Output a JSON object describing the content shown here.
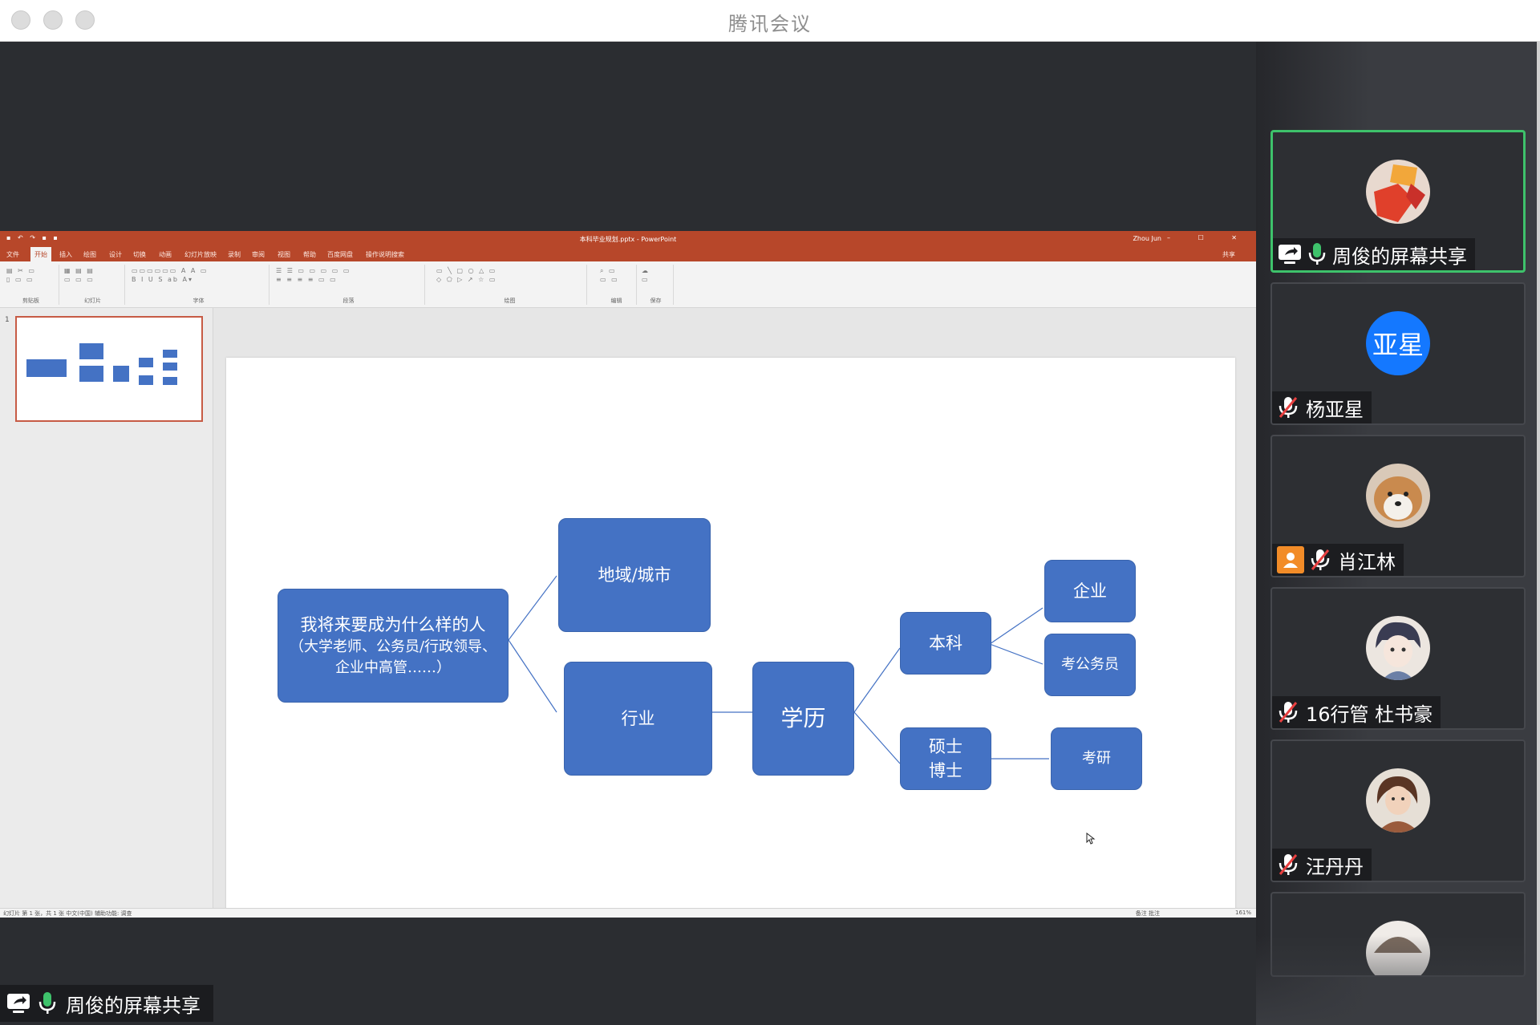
{
  "window": {
    "title": "腾讯会议"
  },
  "ppt": {
    "doc_title": "本科毕业规划.pptx  -  PowerPoint",
    "user": "Zhou Jun",
    "quick_access": "▪ ↶ ↷ ▪ ▪",
    "window_controls": "– ☐ ✕",
    "tabs": [
      "文件",
      "开始",
      "插入",
      "绘图",
      "设计",
      "切换",
      "动画",
      "幻灯片放映",
      "录制",
      "审阅",
      "视图",
      "帮助",
      "百度网盘",
      "操作说明搜索"
    ],
    "share_label": "共享",
    "ribbon_groups": [
      "剪贴板",
      "幻灯片",
      "字体",
      "段落",
      "绘图",
      "编辑",
      "保存"
    ],
    "thumb_number": "1",
    "status_left": "幻灯片 第 1 张，共 1 张    中文(中国)    辅助功能: 调查",
    "status_right": "备注    批注",
    "zoom": "161%"
  },
  "slide": {
    "nodes": {
      "main_line1": "我将来要成为什么样的人",
      "main_line2": "（大学老师、公务员/行政领导、企业中高管……）",
      "region": "地域/城市",
      "industry": "行业",
      "education": "学历",
      "bachelor": "本科",
      "master_line1": "硕士",
      "master_line2": "博士",
      "enterprise": "企业",
      "civil_service": "考公务员",
      "postgrad": "考研"
    }
  },
  "screen_share": {
    "label": "周俊的屏幕共享"
  },
  "participants": [
    {
      "name": "周俊的屏幕共享",
      "avatar": "photo-red",
      "active": true,
      "mic": "on"
    },
    {
      "name": "杨亚星",
      "avatar_text": "亚星",
      "mic": "muted"
    },
    {
      "name": "肖江林",
      "avatar": "photo-dog",
      "mic": "muted",
      "host": true
    },
    {
      "name": "16行管 杜书豪",
      "avatar": "photo-anime",
      "mic": "muted"
    },
    {
      "name": "汪丹丹",
      "avatar": "photo-person",
      "mic": "muted"
    }
  ],
  "colors": {
    "node_blue": "#4472c4",
    "ppt_red": "#b7472a",
    "active_green": "#3ec26b",
    "avatar_blue": "#1478ff",
    "host_orange": "#f28c28"
  }
}
